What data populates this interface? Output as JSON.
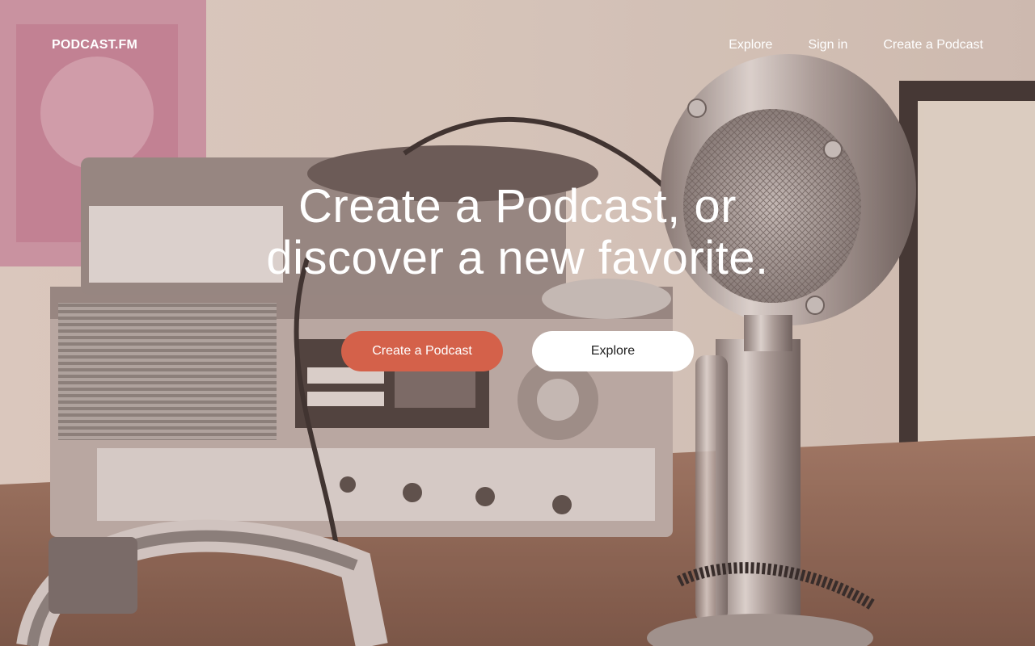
{
  "brand": {
    "logo_text": "PODCAST.FM"
  },
  "nav": {
    "links": [
      {
        "label": "Explore"
      },
      {
        "label": "Sign in"
      },
      {
        "label": "Create a Podcast"
      }
    ]
  },
  "hero": {
    "headline_line1": "Create a Podcast, or",
    "headline_line2": "discover a new favorite.",
    "primary_cta": "Create a Podcast",
    "secondary_cta": "Explore",
    "background_image": "vintage radio and chrome microphone on wooden desk"
  },
  "colors": {
    "accent": "#d4614a",
    "text_on_image": "#ffffff",
    "secondary_button_bg": "#ffffff"
  }
}
